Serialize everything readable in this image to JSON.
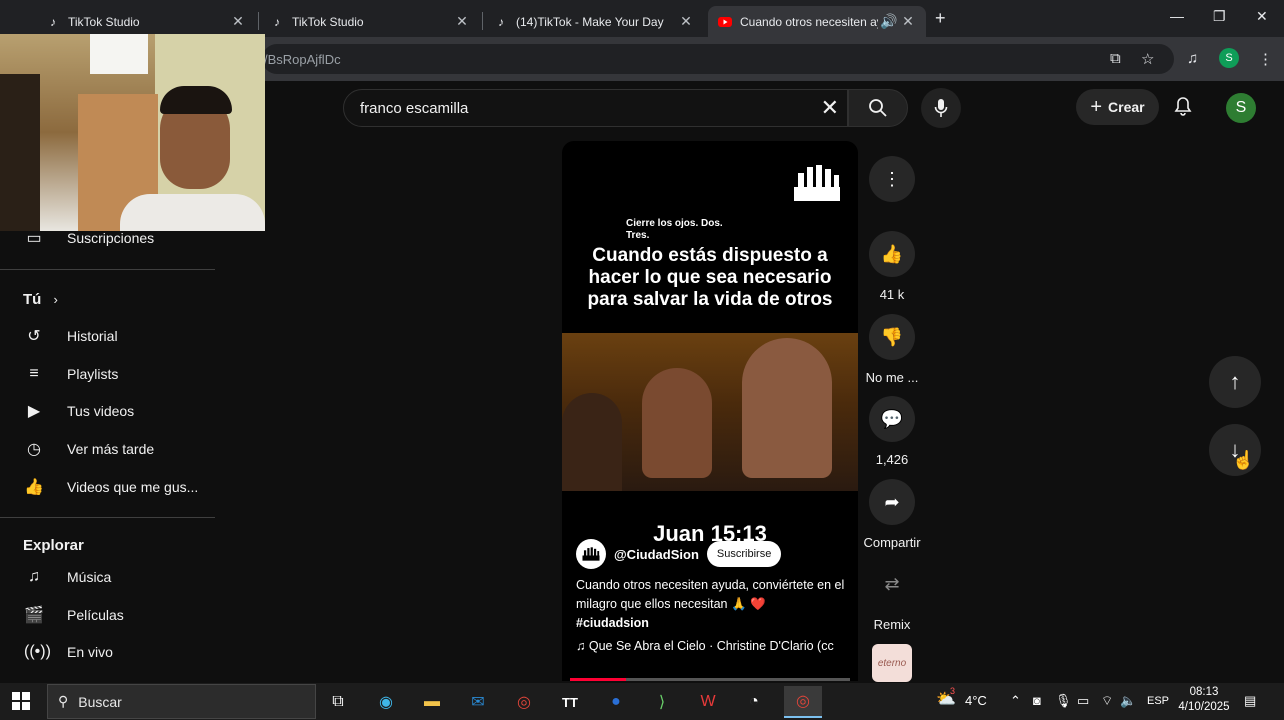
{
  "browser": {
    "tabs": [
      {
        "title": "TikTok Studio",
        "icon": "tiktok-icon",
        "active": false
      },
      {
        "title": "TikTok Studio",
        "icon": "tiktok-icon",
        "active": false
      },
      {
        "title": "(14)TikTok - Make Your Day",
        "icon": "tiktok-icon",
        "active": false
      },
      {
        "title": "Cuando otros necesiten ayu",
        "icon": "youtube-icon",
        "active": true
      }
    ],
    "url": "/BsRopAjflDc",
    "profile_initial": "S"
  },
  "header": {
    "search_query": "franco escamilla",
    "create_label": "Crear",
    "avatar_initial": "S"
  },
  "sidebar": {
    "subscriptions_label": "Suscripciones",
    "you_heading": "Tú",
    "you_items": [
      {
        "label": "Historial",
        "icon": "history-icon"
      },
      {
        "label": "Playlists",
        "icon": "playlists-icon"
      },
      {
        "label": "Tus videos",
        "icon": "your-videos-icon"
      },
      {
        "label": "Ver más tarde",
        "icon": "watch-later-icon"
      },
      {
        "label": "Videos que me gus...",
        "icon": "liked-videos-icon"
      }
    ],
    "explore_heading": "Explorar",
    "explore_items": [
      {
        "label": "Música",
        "icon": "music-icon"
      },
      {
        "label": "Películas",
        "icon": "movies-icon"
      },
      {
        "label": "En vivo",
        "icon": "live-icon"
      }
    ]
  },
  "short": {
    "small_text": "Cierre los ojos. Dos. Tres.",
    "headline": "Cuando estás dispuesto a hacer lo que sea necesario para salvar la vida de otros",
    "verse": "Juan 15:13",
    "channel": "@CiudadSion",
    "subscribe_label": "Suscribirse",
    "description": "Cuando otros necesiten ayuda, conviértete en el milagro que ellos necesitan 🙏 ❤️",
    "hashtag": "#ciudadsion",
    "music": "Que Se Abra el Cielo · Christine D'Clario (cc",
    "progress_fraction": 0.2
  },
  "actions": {
    "likes": "41 k",
    "dislike_label": "No me ...",
    "comments": "1,426",
    "share_label": "Compartir",
    "remix_label": "Remix",
    "remix_thumb_text": "eterno"
  },
  "taskbar": {
    "search_placeholder": "Buscar",
    "weather": "4°C",
    "language": "ESP",
    "time": "08:13",
    "date": "4/10/2025",
    "weather_badge": "3"
  }
}
